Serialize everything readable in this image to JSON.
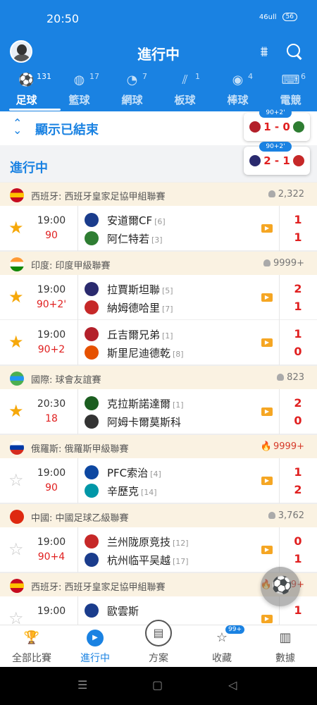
{
  "status_bar": {
    "time": "20:50",
    "signal": "46ull",
    "battery": "56"
  },
  "header": {
    "title": "進行中"
  },
  "tabs": [
    {
      "label": "足球",
      "count": "131",
      "icon": "soccer-ball-icon",
      "glyph": "⚽",
      "active": true
    },
    {
      "label": "籃球",
      "count": "17",
      "icon": "basketball-icon",
      "glyph": "◍"
    },
    {
      "label": "網球",
      "count": "7",
      "icon": "tennis-ball-icon",
      "glyph": "◔"
    },
    {
      "label": "板球",
      "count": "1",
      "icon": "cricket-bat-icon",
      "glyph": "⫽"
    },
    {
      "label": "棒球",
      "count": "4",
      "icon": "baseball-icon",
      "glyph": "◉"
    },
    {
      "label": "電競",
      "count": "6",
      "icon": "gamepad-icon",
      "glyph": "⌨"
    }
  ],
  "show_ended": {
    "label": "顯示已結束"
  },
  "live_section": {
    "label": "進行中"
  },
  "mini_scores": [
    {
      "minute": "90+2'",
      "score": "1 - 0",
      "home_color": "#b3202a",
      "away_color": "#2e7d32"
    },
    {
      "minute": "90+2'",
      "score": "2 - 1",
      "home_color": "#2a2a6e",
      "away_color": "#c62828"
    }
  ],
  "groups": [
    {
      "league": "西班牙: 西班牙皇家足協甲組聯賽",
      "flag_colors": [
        "#c60b1e",
        "#ffc400",
        "#c60b1e"
      ],
      "viewers": "2,322",
      "hot": false,
      "matches": [
        {
          "favorite": true,
          "time": "19:00",
          "minute": "90",
          "home": "安道爾CF",
          "home_rank": "[6]",
          "away": "阿仁特若",
          "away_rank": "[3]",
          "home_score": "1",
          "away_score": "1",
          "home_color": "#1a3c8c",
          "away_color": "#2e7d32"
        }
      ]
    },
    {
      "league": "印度: 印度甲級聯賽",
      "flag_colors": [
        "#ff9933",
        "#ffffff",
        "#138808"
      ],
      "viewers": "9999+",
      "hot": false,
      "matches": [
        {
          "favorite": true,
          "time": "19:00",
          "minute": "90+2'",
          "home": "拉賈斯坦聯",
          "home_rank": "[5]",
          "away": "納姆德哈里",
          "away_rank": "[7]",
          "home_score": "2",
          "away_score": "1",
          "home_color": "#2a2a6e",
          "away_color": "#c62828"
        },
        {
          "favorite": true,
          "time": "19:00",
          "minute": "90+2",
          "home": "丘吉爾兄弟",
          "home_rank": "[1]",
          "away": "斯里尼迪德乾",
          "away_rank": "[8]",
          "home_score": "1",
          "away_score": "0",
          "home_color": "#b3202a",
          "away_color": "#e65100"
        }
      ]
    },
    {
      "league": "國際: 球會友誼賽",
      "flag_colors": [
        "#4caf50",
        "#2196f3",
        "#4caf50"
      ],
      "viewers": "823",
      "hot": false,
      "matches": [
        {
          "favorite": true,
          "time": "20:30",
          "minute": "18",
          "home": "克拉斯諾達爾",
          "home_rank": "[1]",
          "away": "阿姆卡爾莫斯科",
          "away_rank": "",
          "home_score": "2",
          "away_score": "0",
          "home_color": "#1b5e20",
          "away_color": "#333333"
        }
      ]
    },
    {
      "league": "俄羅斯: 俄羅斯甲級聯賽",
      "flag_colors": [
        "#ffffff",
        "#0039a6",
        "#d52b1e"
      ],
      "viewers": "9999+",
      "hot": true,
      "matches": [
        {
          "favorite": false,
          "time": "19:00",
          "minute": "90",
          "home": "PFC索治",
          "home_rank": "[4]",
          "away": "辛歷克",
          "away_rank": "[14]",
          "home_score": "1",
          "away_score": "2",
          "home_color": "#0d47a1",
          "away_color": "#0097a7"
        }
      ]
    },
    {
      "league": "中國: 中國足球乙級聯賽",
      "flag_colors": [
        "#de2910",
        "#de2910",
        "#de2910"
      ],
      "viewers": "3,762",
      "hot": false,
      "matches": [
        {
          "favorite": false,
          "time": "19:00",
          "minute": "90+4",
          "home": "兰州陇原竞技",
          "home_rank": "[12]",
          "away": "杭州临平吴越",
          "away_rank": "[17]",
          "home_score": "0",
          "away_score": "1",
          "home_color": "#c62828",
          "away_color": "#1a3c8c"
        }
      ]
    },
    {
      "league": "西班牙: 西班牙皇家足協甲組聯賽",
      "flag_colors": [
        "#c60b1e",
        "#ffc400",
        "#c60b1e"
      ],
      "viewers": "9999+",
      "hot": true,
      "matches": [
        {
          "favorite": false,
          "time": "19:00",
          "minute": "",
          "home": "歐雲斯",
          "home_rank": "",
          "away": "",
          "away_rank": "",
          "home_score": "1",
          "away_score": "",
          "home_color": "#1a3c8c",
          "away_color": "#ffffff"
        }
      ]
    }
  ],
  "bottom_nav": [
    {
      "label": "全部比賽",
      "icon": "trophy-icon",
      "glyph": "🏆"
    },
    {
      "label": "進行中",
      "icon": "play-icon",
      "glyph": "▶",
      "active": true
    },
    {
      "label": "方案",
      "icon": "document-icon",
      "glyph": "▤"
    },
    {
      "label": "收藏",
      "icon": "star-icon",
      "glyph": "☆",
      "badge": "99+"
    },
    {
      "label": "數據",
      "icon": "bar-chart-icon",
      "glyph": "▥"
    }
  ],
  "system_nav": {
    "menu": "☰",
    "home": "▢",
    "back": "◁"
  }
}
